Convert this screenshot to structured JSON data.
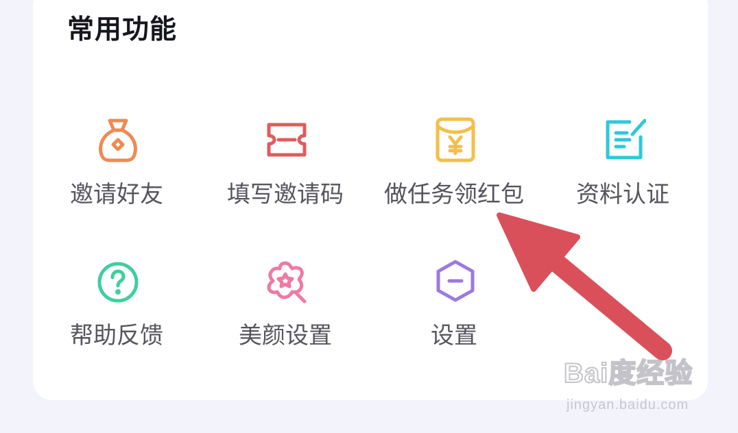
{
  "section": {
    "title": "常用功能"
  },
  "features": [
    {
      "label": "邀请好友",
      "icon": "money-bag-icon",
      "color": "#ef8a52"
    },
    {
      "label": "填写邀请码",
      "icon": "ticket-icon",
      "color": "#e05c5c"
    },
    {
      "label": "做任务领红包",
      "icon": "red-envelope-icon",
      "color": "#f2c04a"
    },
    {
      "label": "资料认证",
      "icon": "edit-document-icon",
      "color": "#2ec8d8"
    },
    {
      "label": "帮助反馈",
      "icon": "help-question-icon",
      "color": "#3ecf9c"
    },
    {
      "label": "美颜设置",
      "icon": "beauty-flower-icon",
      "color": "#ee7aa0"
    },
    {
      "label": "设置",
      "icon": "settings-hexagon-icon",
      "color": "#9b7ae0"
    }
  ],
  "annotation": {
    "arrow_color": "#d9505a"
  },
  "watermark": {
    "logo": "Bai度经验",
    "url": "jingyan.baidu.com"
  }
}
